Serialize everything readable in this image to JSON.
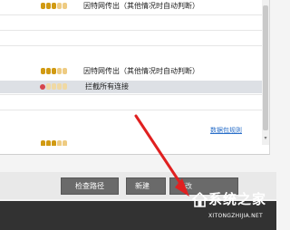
{
  "rules": [
    {
      "text": "因特网传出（其他情况时自动判断）",
      "level": "orange"
    },
    {
      "text": "因特网传出（其他情况时自动判断）",
      "level": "orange"
    },
    {
      "text": "拦截所有连接",
      "level": "red"
    }
  ],
  "link_text": "数据包规则",
  "buttons": {
    "check_path": "检查路径",
    "new": "新建",
    "modify": "修改"
  },
  "colors": {
    "dot_orange": "#d19a12",
    "dot_light": "#eecb82",
    "dot_red": "#d6454c",
    "link": "#2a6fc9",
    "arrow": "#e02020",
    "button": "#6a6a6a"
  },
  "watermark": {
    "title": "系统之家",
    "url": "XITONGZHIJIA.NET"
  },
  "icons": {
    "level_icon": "security-level-dots",
    "arrow": "red-arrow-annotation",
    "logo": "house-logo-icon"
  }
}
